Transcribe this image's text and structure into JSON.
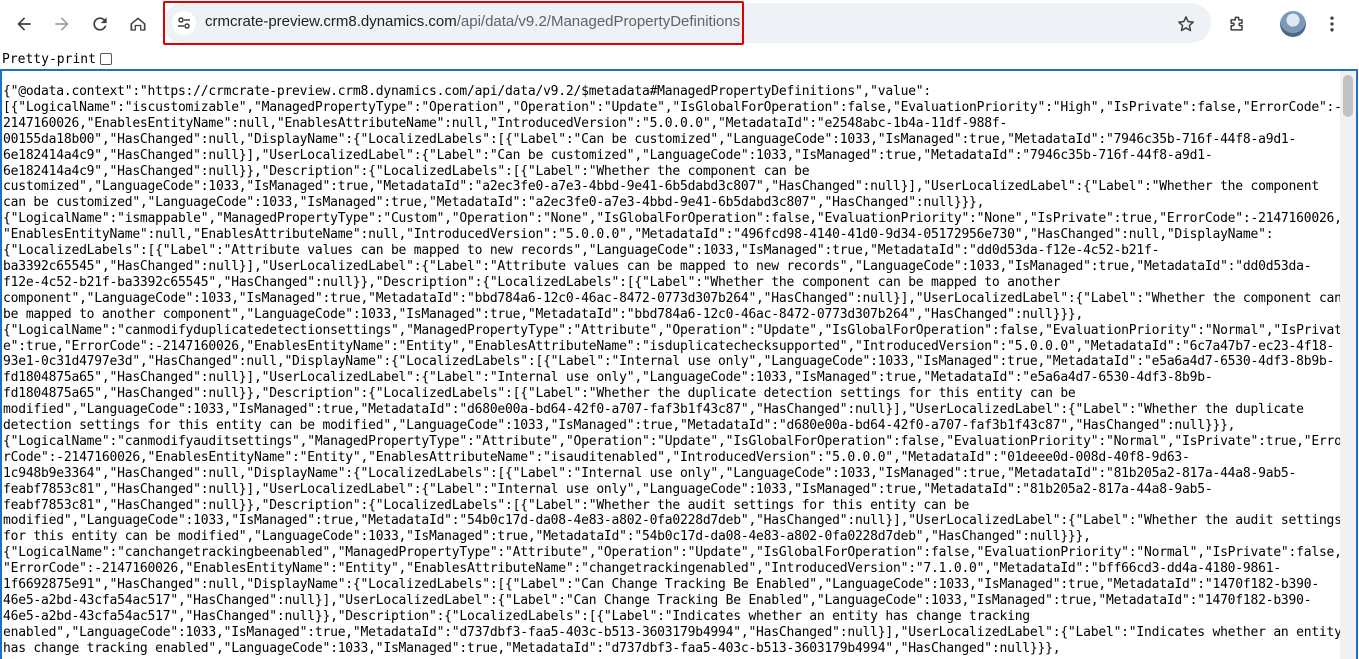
{
  "browser": {
    "url_host": "crmcrate-preview.crm8.dynamics.com",
    "url_path": "/api/data/v9.2/ManagedPropertyDefinitions",
    "icons": {
      "back": "back-arrow-icon",
      "forward": "forward-arrow-icon",
      "reload": "reload-icon",
      "home": "home-icon",
      "site_info": "tune-icon",
      "bookmark": "star-icon",
      "extensions": "puzzle-icon",
      "profile": "avatar-icon",
      "menu": "kebab-menu-icon"
    },
    "highlight_color": "#e00000"
  },
  "pretty_print": {
    "label": "Pretty-print",
    "checked": false
  },
  "json_lines": [
    "{\"@odata.context\":\"https://crmcrate-preview.crm8.dynamics.com/api/data/v9.2/$metadata#ManagedPropertyDefinitions\",\"value\":",
    "[{\"LogicalName\":\"iscustomizable\",\"ManagedPropertyType\":\"Operation\",\"Operation\":\"Update\",\"IsGlobalForOperation\":false,\"EvaluationPriority\":\"High\",\"IsPrivate\":false,\"ErrorCode\":-",
    "2147160026,\"EnablesEntityName\":null,\"EnablesAttributeName\":null,\"IntroducedVersion\":\"5.0.0.0\",\"MetadataId\":\"e2548abc-1b4a-11df-988f-",
    "00155da18b00\",\"HasChanged\":null,\"DisplayName\":{\"LocalizedLabels\":[{\"Label\":\"Can be customized\",\"LanguageCode\":1033,\"IsManaged\":true,\"MetadataId\":\"7946c35b-716f-44f8-a9d1-",
    "6e182414a4c9\",\"HasChanged\":null}],\"UserLocalizedLabel\":{\"Label\":\"Can be customized\",\"LanguageCode\":1033,\"IsManaged\":true,\"MetadataId\":\"7946c35b-716f-44f8-a9d1-",
    "6e182414a4c9\",\"HasChanged\":null}},\"Description\":{\"LocalizedLabels\":[{\"Label\":\"Whether the component can be",
    "customized\",\"LanguageCode\":1033,\"IsManaged\":true,\"MetadataId\":\"a2ec3fe0-a7e3-4bbd-9e41-6b5dabd3c807\",\"HasChanged\":null}],\"UserLocalizedLabel\":{\"Label\":\"Whether the component",
    "can be customized\",\"LanguageCode\":1033,\"IsManaged\":true,\"MetadataId\":\"a2ec3fe0-a7e3-4bbd-9e41-6b5dabd3c807\",\"HasChanged\":null}}},",
    "{\"LogicalName\":\"ismappable\",\"ManagedPropertyType\":\"Custom\",\"Operation\":\"None\",\"IsGlobalForOperation\":false,\"EvaluationPriority\":\"None\",\"IsPrivate\":true,\"ErrorCode\":-2147160026,",
    "\"EnablesEntityName\":null,\"EnablesAttributeName\":null,\"IntroducedVersion\":\"5.0.0.0\",\"MetadataId\":\"496fcd98-4140-41d0-9d34-05172956e730\",\"HasChanged\":null,\"DisplayName\":",
    "{\"LocalizedLabels\":[{\"Label\":\"Attribute values can be mapped to new records\",\"LanguageCode\":1033,\"IsManaged\":true,\"MetadataId\":\"dd0d53da-f12e-4c52-b21f-",
    "ba3392c65545\",\"HasChanged\":null}],\"UserLocalizedLabel\":{\"Label\":\"Attribute values can be mapped to new records\",\"LanguageCode\":1033,\"IsManaged\":true,\"MetadataId\":\"dd0d53da-",
    "f12e-4c52-b21f-ba3392c65545\",\"HasChanged\":null}},\"Description\":{\"LocalizedLabels\":[{\"Label\":\"Whether the component can be mapped to another",
    "component\",\"LanguageCode\":1033,\"IsManaged\":true,\"MetadataId\":\"bbd784a6-12c0-46ac-8472-0773d307b264\",\"HasChanged\":null}],\"UserLocalizedLabel\":{\"Label\":\"Whether the component can",
    "be mapped to another component\",\"LanguageCode\":1033,\"IsManaged\":true,\"MetadataId\":\"bbd784a6-12c0-46ac-8472-0773d307b264\",\"HasChanged\":null}}},",
    "{\"LogicalName\":\"canmodifyduplicatedetectionsettings\",\"ManagedPropertyType\":\"Attribute\",\"Operation\":\"Update\",\"IsGlobalForOperation\":false,\"EvaluationPriority\":\"Normal\",\"IsPrivat",
    "e\":true,\"ErrorCode\":-2147160026,\"EnablesEntityName\":\"Entity\",\"EnablesAttributeName\":\"isduplicatechecksupported\",\"IntroducedVersion\":\"5.0.0.0\",\"MetadataId\":\"6c7a47b7-ec23-4f18-",
    "93e1-0c31d4797e3d\",\"HasChanged\":null,\"DisplayName\":{\"LocalizedLabels\":[{\"Label\":\"Internal use only\",\"LanguageCode\":1033,\"IsManaged\":true,\"MetadataId\":\"e5a6a4d7-6530-4df3-8b9b-",
    "fd1804875a65\",\"HasChanged\":null}],\"UserLocalizedLabel\":{\"Label\":\"Internal use only\",\"LanguageCode\":1033,\"IsManaged\":true,\"MetadataId\":\"e5a6a4d7-6530-4df3-8b9b-",
    "fd1804875a65\",\"HasChanged\":null}},\"Description\":{\"LocalizedLabels\":[{\"Label\":\"Whether the duplicate detection settings for this entity can be",
    "modified\",\"LanguageCode\":1033,\"IsManaged\":true,\"MetadataId\":\"d680e00a-bd64-42f0-a707-faf3b1f43c87\",\"HasChanged\":null}],\"UserLocalizedLabel\":{\"Label\":\"Whether the duplicate",
    "detection settings for this entity can be modified\",\"LanguageCode\":1033,\"IsManaged\":true,\"MetadataId\":\"d680e00a-bd64-42f0-a707-faf3b1f43c87\",\"HasChanged\":null}}},",
    "{\"LogicalName\":\"canmodifyauditsettings\",\"ManagedPropertyType\":\"Attribute\",\"Operation\":\"Update\",\"IsGlobalForOperation\":false,\"EvaluationPriority\":\"Normal\",\"IsPrivate\":true,\"Erro",
    "rCode\":-2147160026,\"EnablesEntityName\":\"Entity\",\"EnablesAttributeName\":\"isauditenabled\",\"IntroducedVersion\":\"5.0.0.0\",\"MetadataId\":\"01deee0d-008d-40f8-9d63-",
    "1c948b9e3364\",\"HasChanged\":null,\"DisplayName\":{\"LocalizedLabels\":[{\"Label\":\"Internal use only\",\"LanguageCode\":1033,\"IsManaged\":true,\"MetadataId\":\"81b205a2-817a-44a8-9ab5-",
    "feabf7853c81\",\"HasChanged\":null}],\"UserLocalizedLabel\":{\"Label\":\"Internal use only\",\"LanguageCode\":1033,\"IsManaged\":true,\"MetadataId\":\"81b205a2-817a-44a8-9ab5-",
    "feabf7853c81\",\"HasChanged\":null}},\"Description\":{\"LocalizedLabels\":[{\"Label\":\"Whether the audit settings for this entity can be",
    "modified\",\"LanguageCode\":1033,\"IsManaged\":true,\"MetadataId\":\"54b0c17d-da08-4e83-a802-0fa0228d7deb\",\"HasChanged\":null}],\"UserLocalizedLabel\":{\"Label\":\"Whether the audit settings",
    "for this entity can be modified\",\"LanguageCode\":1033,\"IsManaged\":true,\"MetadataId\":\"54b0c17d-da08-4e83-a802-0fa0228d7deb\",\"HasChanged\":null}}},",
    "{\"LogicalName\":\"canchangetrackingbeenabled\",\"ManagedPropertyType\":\"Attribute\",\"Operation\":\"Update\",\"IsGlobalForOperation\":false,\"EvaluationPriority\":\"Normal\",\"IsPrivate\":false,",
    "\"ErrorCode\":-2147160026,\"EnablesEntityName\":\"Entity\",\"EnablesAttributeName\":\"changetrackingenabled\",\"IntroducedVersion\":\"7.1.0.0\",\"MetadataId\":\"bff66cd3-dd4a-4180-9861-",
    "1f6692875e91\",\"HasChanged\":null,\"DisplayName\":{\"LocalizedLabels\":[{\"Label\":\"Can Change Tracking Be Enabled\",\"LanguageCode\":1033,\"IsManaged\":true,\"MetadataId\":\"1470f182-b390-",
    "46e5-a2bd-43cfa54ac517\",\"HasChanged\":null}],\"UserLocalizedLabel\":{\"Label\":\"Can Change Tracking Be Enabled\",\"LanguageCode\":1033,\"IsManaged\":true,\"MetadataId\":\"1470f182-b390-",
    "46e5-a2bd-43cfa54ac517\",\"HasChanged\":null}},\"Description\":{\"LocalizedLabels\":[{\"Label\":\"Indicates whether an entity has change tracking",
    "enabled\",\"LanguageCode\":1033,\"IsManaged\":true,\"MetadataId\":\"d737dbf3-faa5-403c-b513-3603179b4994\",\"HasChanged\":null}],\"UserLocalizedLabel\":{\"Label\":\"Indicates whether an entity",
    "has change tracking enabled\",\"LanguageCode\":1033,\"IsManaged\":true,\"MetadataId\":\"d737dbf3-faa5-403c-b513-3603179b4994\",\"HasChanged\":null}}},"
  ],
  "colors": {
    "content_border": "#1b70c7",
    "omnibox_bg": "#eef1f5"
  }
}
